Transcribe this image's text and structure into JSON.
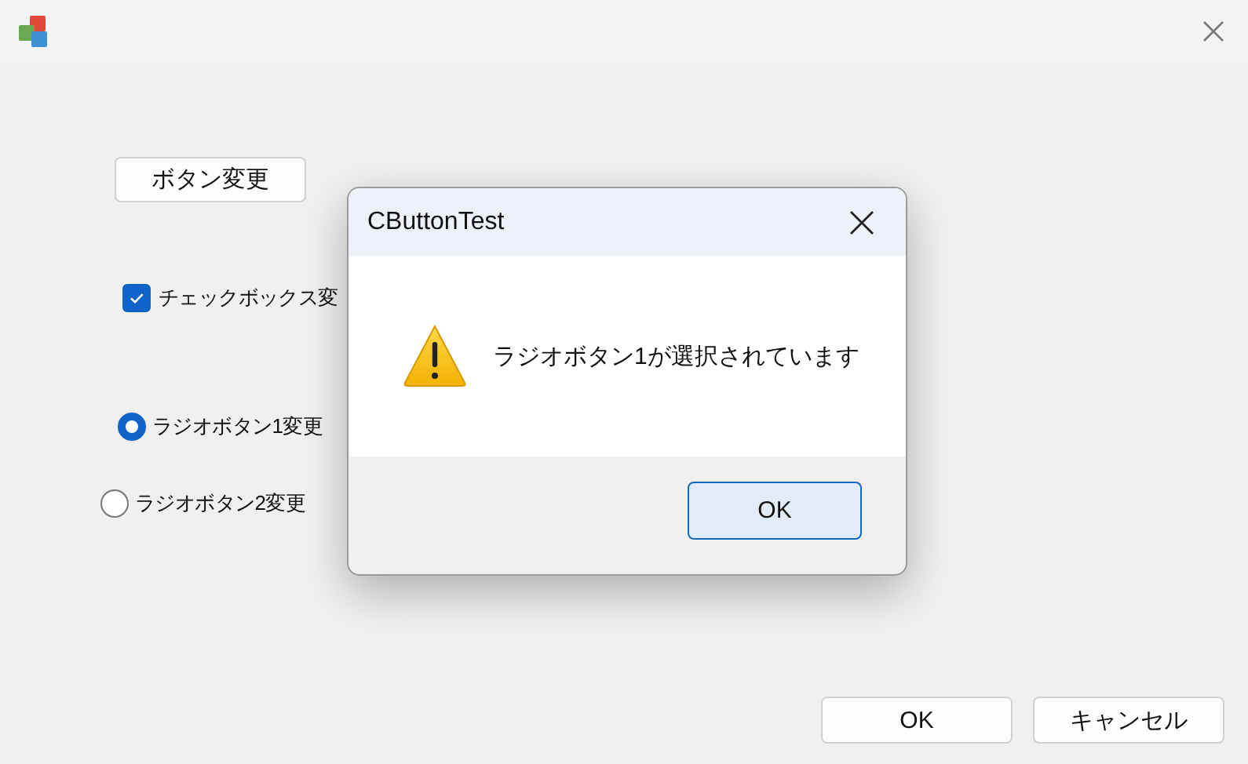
{
  "main_window": {
    "change_button": "ボタン変更",
    "checkbox": {
      "label": "チェックボックス変",
      "checked": true
    },
    "radios": [
      {
        "label": "ラジオボタン1変更",
        "selected": true
      },
      {
        "label": "ラジオボタン2変更",
        "selected": false
      }
    ],
    "buttons": [
      {
        "label": "OK"
      },
      {
        "label": "キャンセル"
      }
    ]
  },
  "message_box": {
    "title": "CButtonTest",
    "message": "ラジオボタン1が選択されています",
    "buttons": [
      {
        "label": "OK",
        "default": true
      }
    ]
  }
}
